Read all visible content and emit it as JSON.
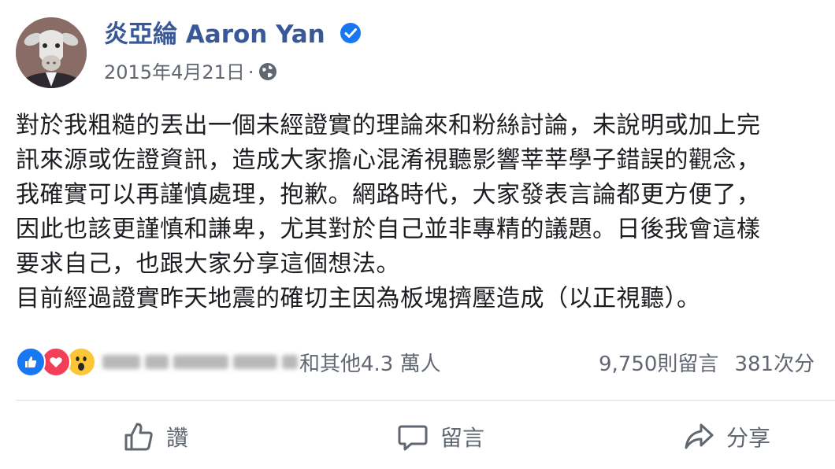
{
  "post": {
    "author_name": "炎亞綸 Aaron Yan",
    "date": "2015年4月21日",
    "separator": "·",
    "privacy_icon": "globe-icon",
    "verified_icon": "verified-badge-icon",
    "body_lines": [
      "對於我粗糙的丟出一個未經證實的理論來和粉絲討論，未說明或加上完",
      "訊來源或佐證資訊，造成大家擔心混淆視聽影響莘莘學子錯誤的觀念，",
      "我確實可以再謹慎處理，抱歉。網路時代，大家發表言論都更方便了，",
      "因此也該更謹慎和謙卑，尤其對於自己並非專精的議題。日後我會這樣",
      "要求自己，也跟大家分享這個想法。",
      "目前經過證實昨天地震的確切主因為板塊擠壓造成（以正視聽）。"
    ]
  },
  "reactions": {
    "icons": [
      "like-reaction-icon",
      "love-reaction-icon",
      "wow-reaction-icon"
    ],
    "others_text": "和其他4.3 萬人",
    "comments_count": "9,750則留言",
    "shares_count": "381次分"
  },
  "actions": {
    "like_label": "讚",
    "comment_label": "留言",
    "share_label": "分享"
  },
  "colors": {
    "author": "#385898",
    "verified": "#1877f2",
    "secondary_text": "#606770",
    "like": "#1877f2",
    "love": "#f33e58",
    "wow": "#fcc636"
  }
}
